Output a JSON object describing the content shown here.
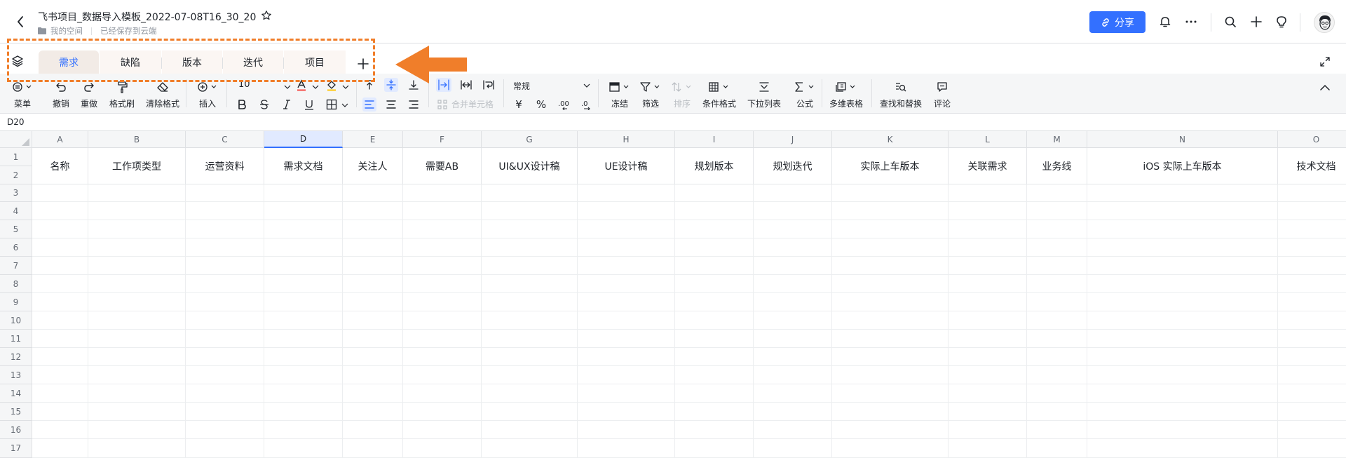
{
  "header": {
    "title": "飞书项目_数据导入模板_2022-07-08T16_30_20",
    "location": "我的空间",
    "save_status": "已经保存到云端",
    "share_label": "分享"
  },
  "sheet_tabs": [
    {
      "label": "需求",
      "active": true
    },
    {
      "label": "缺陷",
      "active": false
    },
    {
      "label": "版本",
      "active": false
    },
    {
      "label": "迭代",
      "active": false
    },
    {
      "label": "项目",
      "active": false
    }
  ],
  "toolbar": {
    "menu": "菜单",
    "undo": "撤销",
    "redo": "重做",
    "format_painter": "格式刷",
    "clear_format": "清除格式",
    "insert": "插入",
    "font_size": "10",
    "number_format": "常规",
    "merge_cells": "合并单元格",
    "currency_symbol": "¥",
    "percent_symbol": "%",
    "freeze": "冻结",
    "filter": "筛选",
    "sort": "排序",
    "conditional_format": "条件格式",
    "dropdown_list": "下拉列表",
    "formula": "公式",
    "multi_dim_table": "多维表格",
    "find_replace": "查找和替换",
    "comment": "评论"
  },
  "formula_bar": {
    "cell_ref": "D20"
  },
  "grid": {
    "columns": [
      "A",
      "B",
      "C",
      "D",
      "E",
      "F",
      "G",
      "H",
      "I",
      "J",
      "K",
      "L",
      "M",
      "N",
      "O"
    ],
    "selected_column": "D",
    "rows": [
      "1",
      "2",
      "3",
      "4",
      "5",
      "6",
      "7",
      "8",
      "9",
      "10",
      "11",
      "12",
      "13",
      "14",
      "15",
      "16",
      "17"
    ],
    "header_row": [
      "名称",
      "工作项类型",
      "运营资料",
      "需求文档",
      "关注人",
      "需要AB",
      "UI&UX设计稿",
      "UE设计稿",
      "规划版本",
      "规划迭代",
      "实际上车版本",
      "关联需求",
      "业务线",
      "iOS 实际上车版本",
      "技术文档"
    ]
  },
  "colors": {
    "accent": "#3370ff",
    "annotation": "#f07e2a"
  }
}
